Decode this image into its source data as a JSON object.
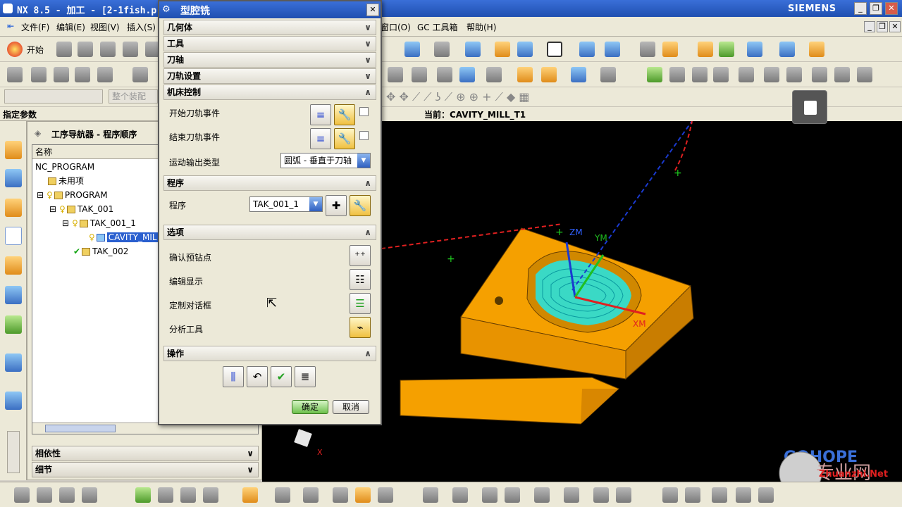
{
  "window": {
    "title": "NX 8.5 - 加工 - [2-1fish.p",
    "brand": "SIEMENS",
    "min": "_",
    "restore": "❐",
    "close": "✕"
  },
  "menubar": {
    "items": [
      "文件(F)",
      "编辑(E)",
      "视图(V)",
      "插入(S)",
      "窗口(O)",
      "GC 工具箱",
      "帮助(H)"
    ]
  },
  "toolbar": {
    "start_label": "开始",
    "assembly_placeholder": "整个装配"
  },
  "left_label": "指定参数",
  "navigator": {
    "title": "工序导航器 - 程序顺序",
    "column_name": "名称",
    "tree": [
      {
        "label": "NC_PROGRAM"
      },
      {
        "label": "未用项"
      },
      {
        "label": "PROGRAM"
      },
      {
        "label": "TAK_001"
      },
      {
        "label": "TAK_001_1"
      },
      {
        "label": "CAVITY_MIL"
      },
      {
        "label": "TAK_002"
      }
    ],
    "panels": [
      "相依性",
      "细节"
    ]
  },
  "viewport": {
    "current_label": "当前：CAVITY_MILL_T1",
    "axis_labels": {
      "zm": "ZM",
      "ym": "YM",
      "xm": "XM",
      "x": "X"
    },
    "watermark_brand": "GOHOPE",
    "watermark_site": "Zhuanzhi.Net",
    "watermark_cn": "专业网"
  },
  "dialog": {
    "title": "型腔铣",
    "close": "✕",
    "sections": {
      "geometry": "几何体",
      "tool": "工具",
      "tool_axis": "刀轴",
      "path_settings": "刀轨设置",
      "machine_control": "机床控制",
      "program": "程序",
      "options": "选项",
      "actions": "操作"
    },
    "machine": {
      "start_event": "开始刀轨事件",
      "end_event": "结束刀轨事件",
      "motion_output": "运动输出类型",
      "motion_value": "圆弧 - 垂直于刀轴"
    },
    "program_label": "程序",
    "program_value": "TAK_001_1",
    "options": {
      "preview_points": "确认预钻点",
      "edit_display": "编辑显示",
      "customize_dialog": "定制对话框",
      "analysis_tools": "分析工具"
    },
    "ok": "确定",
    "cancel": "取消"
  },
  "colors": {
    "title_bar": "#1f4fb0",
    "block_orange": "#f5a000",
    "toolpath_cyan": "#20e8e8"
  }
}
